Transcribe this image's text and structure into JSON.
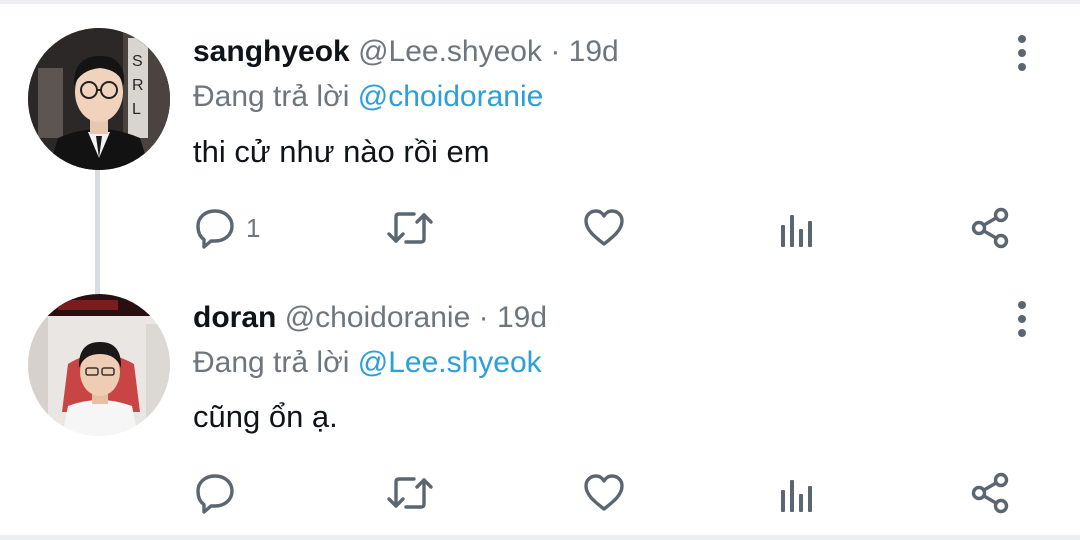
{
  "tweets": [
    {
      "name": "sanghyeok",
      "handle": "@Lee.shyeok",
      "separator": "·",
      "time": "19d",
      "replying_prefix": "Đang trả lời",
      "replying_to": "@choidoranie",
      "text": "thi cử như nào rồi em",
      "reply_count": "1",
      "avatar_icon": "profile-photo"
    },
    {
      "name": "doran",
      "handle": "@choidoranie",
      "separator": "·",
      "time": "19d",
      "replying_prefix": "Đang trả lời",
      "replying_to": "@Lee.shyeok",
      "text": "cũng ổn ạ.",
      "reply_count": "",
      "avatar_icon": "profile-photo"
    }
  ],
  "icons": {
    "reply": "speech-bubble-icon",
    "retweet": "retweet-icon",
    "like": "heart-icon",
    "stats": "analytics-icon",
    "share": "share-icon",
    "more": "more-vertical-icon"
  },
  "colors": {
    "mention": "#2a9fd8",
    "secondary_text": "#6e767d",
    "icon": "#5b6670",
    "thread_line": "#d9dde1"
  }
}
